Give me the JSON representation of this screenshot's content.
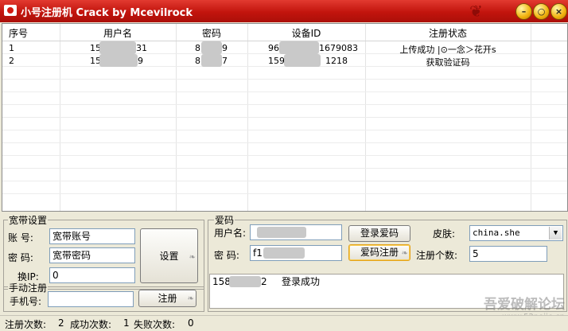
{
  "window": {
    "title": "小号注册机 Crack by Mcevilrock",
    "min_label": "–",
    "max_label": "○",
    "close_label": "×"
  },
  "table": {
    "columns": [
      "序号",
      "用户名",
      "密码",
      "设备ID",
      "注册状态"
    ],
    "rows": [
      {
        "idx": "1",
        "user_a": "15",
        "user_b": "31",
        "pwd_a": "8",
        "pwd_b": "9",
        "dev_a": "96",
        "dev_b": "1679083",
        "status": "上传成功 |⊙一念＞花开s"
      },
      {
        "idx": "2",
        "user_a": "15",
        "user_b": "9",
        "pwd_a": "8",
        "pwd_b": "7",
        "dev_a": "159",
        "dev_b": "1218",
        "status": "获取验证码"
      }
    ]
  },
  "broadband": {
    "group_label": "宽带设置",
    "account_label": "账  号:",
    "account_value": "宽带账号",
    "password_label": "密  码:",
    "password_value": "宽带密码",
    "setup_button": "设置",
    "ip_label": "换IP:",
    "ip_value": "0"
  },
  "manual": {
    "group_label": "手动注册",
    "phone_label": "手机号:",
    "phone_value": "",
    "register_button": "注册"
  },
  "aima": {
    "group_label": "爱码",
    "username_label": "用户名:",
    "password_label": "密  码:",
    "password_prefix": "f1",
    "login_button": "登录爱码",
    "register_button": "爱码注册",
    "skin_label": "皮肤:",
    "skin_value": "china.she",
    "count_label": "注册个数:",
    "count_value": "5",
    "log_prefix": "1581",
    "log_suffix": "2",
    "log_message": "登录成功"
  },
  "status_bar": {
    "total_label": "注册次数:",
    "total_value": "2",
    "success_label": "成功次数:",
    "success_value": "1",
    "fail_label": "失败次数:",
    "fail_value": "0"
  },
  "watermark": {
    "line1": "吾爱破解论坛",
    "line2": "www.52pojie.cn"
  }
}
